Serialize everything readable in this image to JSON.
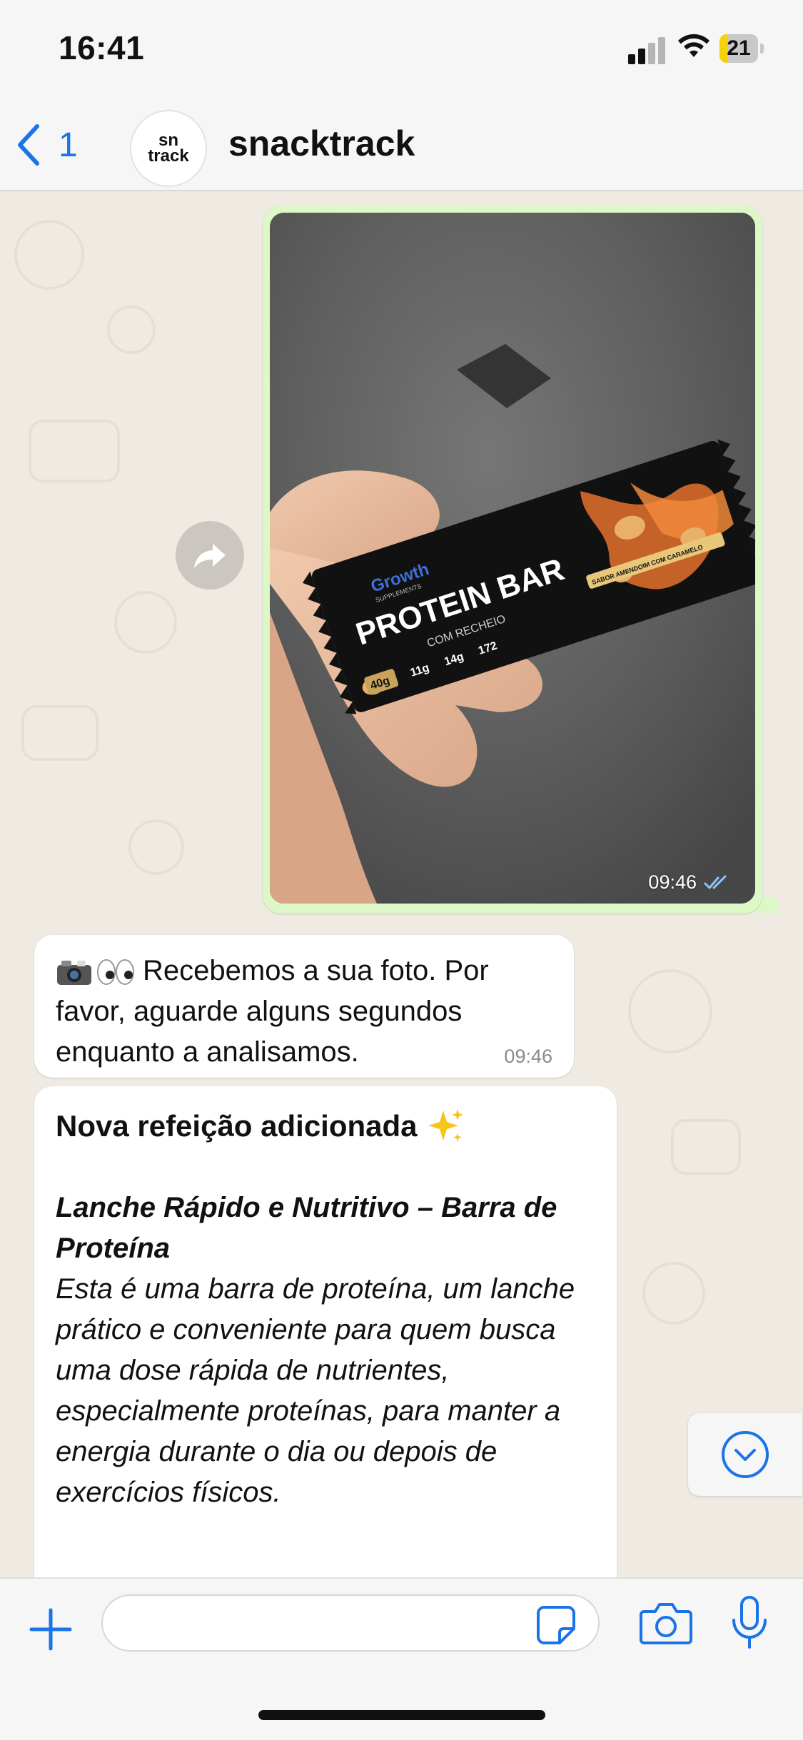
{
  "status_bar": {
    "time": "16:41",
    "battery_level": "21",
    "battery_fraction": 0.21,
    "battery_color": "#f5d20a"
  },
  "header": {
    "back_count": "1",
    "avatar_text_line1": "sn",
    "avatar_text_line2": "track",
    "contact_name": "snacktrack",
    "back_icon": "chevron-left-icon"
  },
  "messages": {
    "photo_message": {
      "time": "09:46",
      "status_icon": "double-check-icon",
      "photo_content": "protein-bar-photo"
    },
    "received_notice": {
      "text": "Recebemos a sua foto. Por favor, aguarde alguns segundos enquanto a analisamos.",
      "time": "09:46",
      "emoji": [
        "camera-with-flash-emoji",
        "eyes-emoji"
      ]
    },
    "meal_added": {
      "title": "Nova refeição adicionada",
      "title_emoji": "sparkles-emoji",
      "subtitle": "Lanche Rápido e Nutritivo – Barra de Proteína",
      "body": "Esta é uma barra de proteína, um lanche prático e conveniente para quem busca uma dose rápida de nutrientes, especialmente proteínas, para manter a energia durante o dia ou depois de exercícios físicos."
    }
  },
  "photo_packaging": {
    "brand": "Growth",
    "brand_sub": "SUPPLEMENTS",
    "product": "PROTEIN BAR",
    "variant": "COM RECHEIO",
    "weight": "40g",
    "protein": "11g",
    "carbs": "14g",
    "calories": "172",
    "flavor": "SABOR AMENDOIM COM CARAMELO"
  },
  "input_bar": {
    "message_value": "",
    "placeholder": ""
  },
  "colors": {
    "accent_blue": "#1a73e8",
    "outgoing_bubble": "#dcf8c6",
    "incoming_bubble": "#ffffff",
    "chat_background": "#efeae2"
  }
}
